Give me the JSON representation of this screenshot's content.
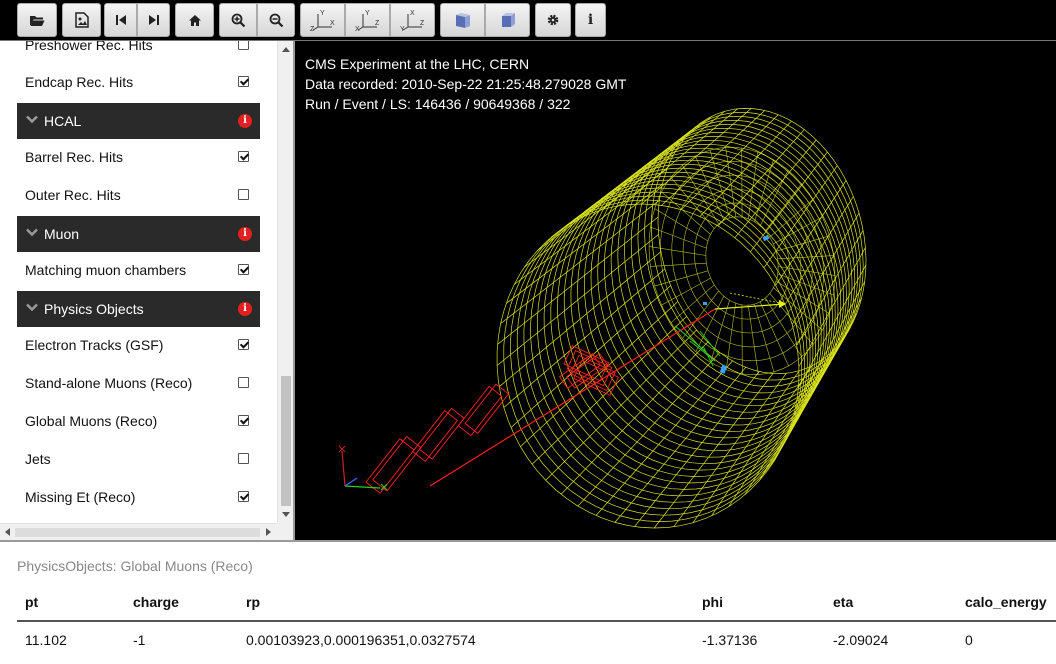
{
  "toolbar": {
    "buttons": [
      {
        "icon": "folder-open-icon"
      },
      {
        "icon": "image-export-icon"
      },
      {
        "icon": "previous-event-icon"
      },
      {
        "icon": "next-event-icon"
      },
      {
        "icon": "home-icon"
      },
      {
        "icon": "zoom-in-icon"
      },
      {
        "icon": "zoom-out-icon"
      },
      {
        "icon": "view-xy-icon"
      },
      {
        "icon": "view-zy-icon"
      },
      {
        "icon": "view-xz-icon"
      },
      {
        "icon": "perspective-view-icon"
      },
      {
        "icon": "orthographic-view-icon"
      },
      {
        "icon": "settings-icon"
      },
      {
        "icon": "info-icon"
      }
    ],
    "axis_labels": {
      "xy": {
        "up": "Y",
        "right": "X",
        "corner": "Z"
      },
      "zy": {
        "up": "Y",
        "right": "Z",
        "corner": "X"
      },
      "xz": {
        "up": "X",
        "right": "Z",
        "corner": "Y"
      }
    },
    "info_glyph": "i"
  },
  "sidebar": {
    "items": [
      {
        "label": "Preshower Rec. Hits",
        "checked": false
      },
      {
        "label": "Endcap Rec. Hits",
        "checked": true
      },
      {
        "label": "Barrel Rec. Hits",
        "checked": true
      },
      {
        "label": "Outer Rec. Hits",
        "checked": false
      },
      {
        "label": "Matching muon chambers",
        "checked": true
      },
      {
        "label": "Electron Tracks (GSF)",
        "checked": true
      },
      {
        "label": "Stand-alone Muons (Reco)",
        "checked": false
      },
      {
        "label": "Global Muons (Reco)",
        "checked": true
      },
      {
        "label": "Jets",
        "checked": false
      },
      {
        "label": "Missing Et (Reco)",
        "checked": true
      }
    ],
    "headers": [
      {
        "label": "HCAL"
      },
      {
        "label": "Muon"
      },
      {
        "label": "Physics Objects"
      }
    ],
    "info_glyph": "i"
  },
  "viewer": {
    "line1": "CMS Experiment at the LHC, CERN",
    "line2": "Data recorded: 2010-Sep-22 21:25:48.279028 GMT",
    "line3": "Run / Event / LS: 146436 / 90649368 / 322",
    "colors": {
      "calorimeter": "#e6f01e",
      "muon": "#ff2020",
      "track": "#20d020",
      "hit": "#3aa0ff"
    }
  },
  "table": {
    "title": "PhysicsObjects: Global Muons (Reco)",
    "columns": [
      "pt",
      "charge",
      "rp",
      "phi",
      "eta",
      "calo_energy"
    ],
    "row": [
      "11.102",
      "-1",
      "0.00103923,0.000196351,0.0327574",
      "-1.37136",
      "-2.09024",
      "0"
    ]
  }
}
